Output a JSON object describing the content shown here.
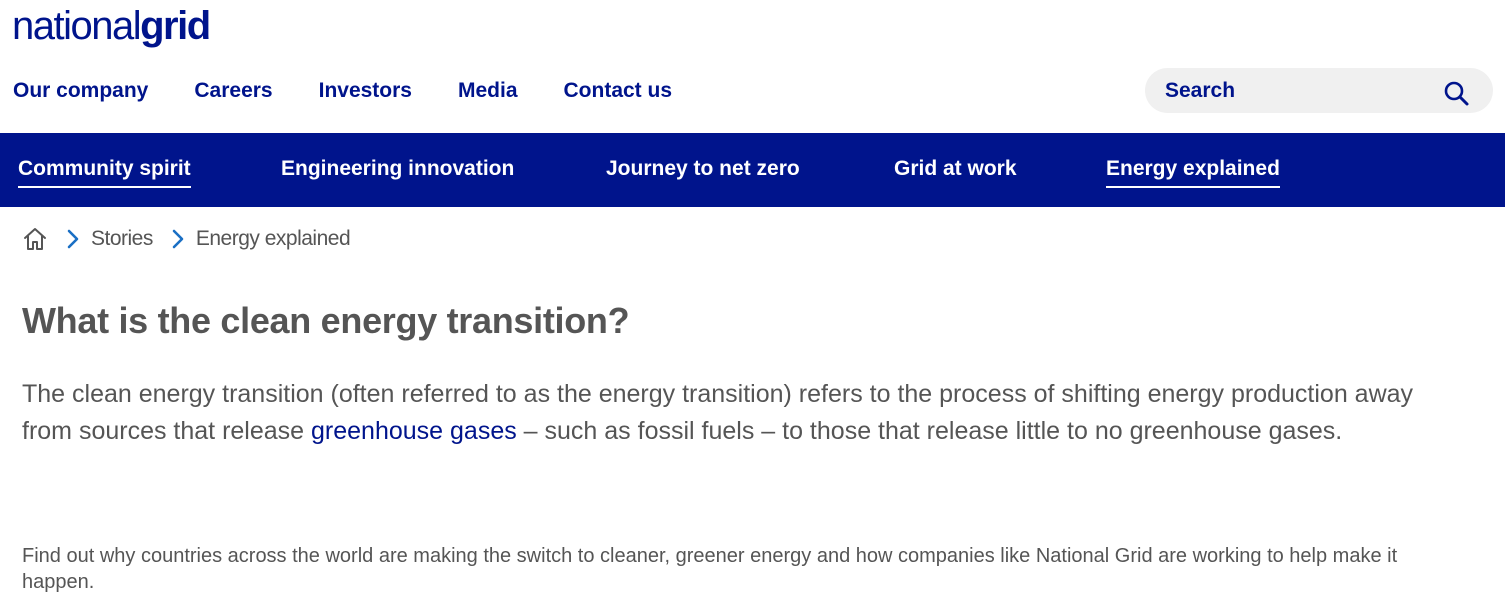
{
  "logo": {
    "part1": "national",
    "part2": "grid"
  },
  "top_nav": [
    {
      "label": "Our company"
    },
    {
      "label": "Careers"
    },
    {
      "label": "Investors"
    },
    {
      "label": "Media"
    },
    {
      "label": "Contact us"
    }
  ],
  "search": {
    "label": "Search",
    "icon": "search-icon"
  },
  "sub_nav": [
    {
      "label": "Community spirit"
    },
    {
      "label": "Engineering innovation"
    },
    {
      "label": "Journey to net zero"
    },
    {
      "label": "Grid at work"
    },
    {
      "label": "Energy explained"
    }
  ],
  "breadcrumb": {
    "home_icon": "home-icon",
    "items": [
      "Stories",
      "Energy explained"
    ]
  },
  "article": {
    "title": "What is the clean energy transition?",
    "lead_before": "The clean energy transition (often referred to as the energy transition) refers to the process of shifting energy production away from sources that release ",
    "lead_link": "greenhouse gases",
    "lead_after": " – such as fossil fuels – to those that release little to no greenhouse gases.",
    "body": "Find out why countries across the world are making the switch to cleaner, greener energy and how companies like National Grid are working to help make it happen."
  },
  "colors": {
    "brand": "#00148c",
    "text": "#555555",
    "search_bg": "#f0f0f0",
    "chevron": "#1a6fc4"
  }
}
